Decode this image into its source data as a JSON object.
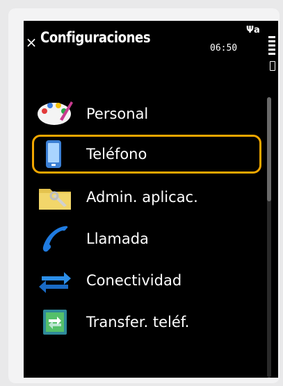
{
  "header": {
    "close_label": "×",
    "title": "Configuraciones",
    "clock": "06:50",
    "signal_label": "Ψa"
  },
  "menu": {
    "items": [
      {
        "label": "Personal",
        "icon": "palette-icon"
      },
      {
        "label": "Teléfono",
        "icon": "phone-icon"
      },
      {
        "label": "Admin. aplicac.",
        "icon": "folder-tools-icon"
      },
      {
        "label": "Llamada",
        "icon": "handset-icon"
      },
      {
        "label": "Conectividad",
        "icon": "exchange-arrows-icon"
      },
      {
        "label": "Transfer. teléf.",
        "icon": "transfer-icon"
      }
    ],
    "selected_index": 1
  },
  "colors": {
    "selection": "#f1a600",
    "background": "#000000"
  }
}
